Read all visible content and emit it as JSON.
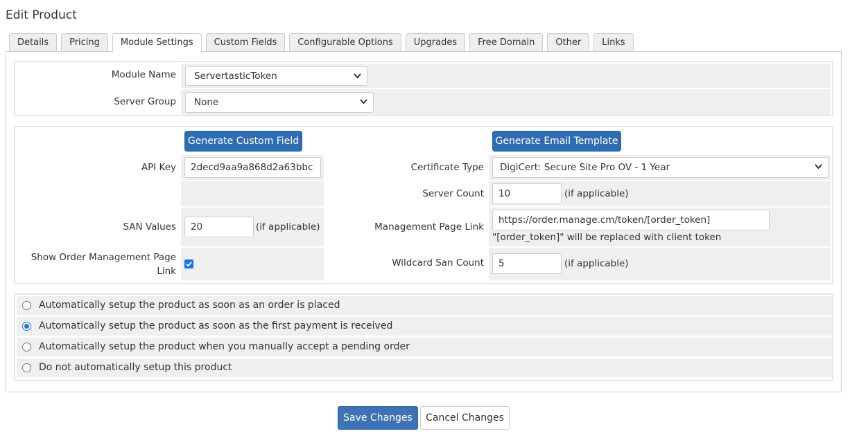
{
  "page": {
    "title": "Edit Product"
  },
  "tabs": [
    {
      "label": "Details"
    },
    {
      "label": "Pricing"
    },
    {
      "label": "Module Settings",
      "active": true
    },
    {
      "label": "Custom Fields"
    },
    {
      "label": "Configurable Options"
    },
    {
      "label": "Upgrades"
    },
    {
      "label": "Free Domain"
    },
    {
      "label": "Other"
    },
    {
      "label": "Links"
    }
  ],
  "module": {
    "module_name_label": "Module Name",
    "module_name_value": "ServertasticToken",
    "server_group_label": "Server Group",
    "server_group_value": "None"
  },
  "config": {
    "generate_custom_field": "Generate Custom Field",
    "generate_email_template": "Generate Email Template",
    "api_key_label": "API Key",
    "api_key_value": "2decd9aa9a868d2a63bbc",
    "certificate_type_label": "Certificate Type",
    "certificate_type_value": "DigiCert: Secure Site Pro OV - 1 Year",
    "server_count_label": "Server Count",
    "server_count_value": "10",
    "server_count_hint": "(if applicable)",
    "san_values_label": "SAN Values",
    "san_values_value": "20",
    "san_values_hint": "(if applicable)",
    "management_link_label": "Management Page Link",
    "management_link_value": "https://order.manage.cm/token/[order_token]",
    "management_link_hint": "\"[order_token]\" will be replaced with client token",
    "show_link_label_line1": "Show Order Management Page",
    "show_link_label_line2": "Link",
    "show_link_checked": true,
    "wildcard_label": "Wildcard San Count",
    "wildcard_value": "5",
    "wildcard_hint": "(if applicable)"
  },
  "setup_options": [
    {
      "label": "Automatically setup the product as soon as an order is placed",
      "checked": false
    },
    {
      "label": "Automatically setup the product as soon as the first payment is received",
      "checked": true
    },
    {
      "label": "Automatically setup the product when you manually accept a pending order",
      "checked": false
    },
    {
      "label": "Do not automatically setup this product",
      "checked": false
    }
  ],
  "actions": {
    "save": "Save Changes",
    "cancel": "Cancel Changes"
  },
  "colors": {
    "primary": "#2f6db3",
    "row_bg": "#efefef",
    "border": "#cccccc"
  }
}
